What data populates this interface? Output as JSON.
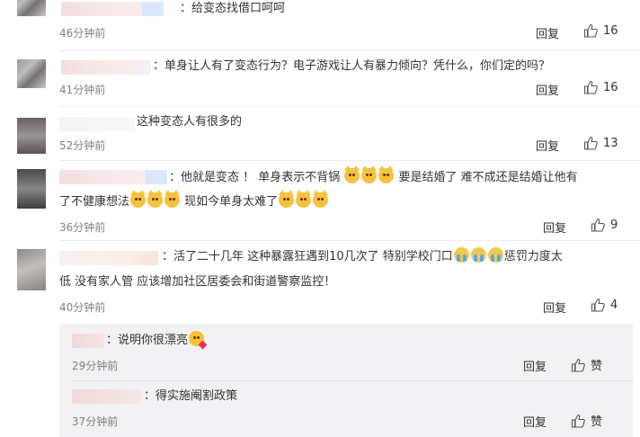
{
  "comments": [
    {
      "text": "：给变态找借口呵呵",
      "time": "46分钟前",
      "reply": "回复",
      "likes": "16"
    },
    {
      "text": "：单身让人有了变态行为？电子游戏让人有暴力倾向？凭什么，你们定的吗？",
      "time": "41分钟前",
      "reply": "回复",
      "likes": "16"
    },
    {
      "text": "这种变态人有很多的",
      "time": "52分钟前",
      "reply": "回复",
      "likes": "13"
    },
    {
      "text_1a": "：他就是变态 ！ 单身表示不背锅",
      "text_1b": "要是结婚了 难不成还是结婚让他有",
      "text_2a": "了不健康想法",
      "text_2b": "现如今单身太难了",
      "time": "36分钟前",
      "reply": "回复",
      "likes": "9"
    },
    {
      "text_1a": "：活了二十几年 这种暴露狂遇到10几次了 特别学校门口",
      "text_1b": "惩罚力度太",
      "text_2": "低 没有家人管 应该增加社区居委会和街道警察监控！",
      "time": "40分钟前",
      "reply": "回复",
      "likes": "4"
    }
  ],
  "sub_replies": [
    {
      "text": "：说明你很漂亮",
      "time": "29分钟前",
      "reply": "回复",
      "like_label": "赞"
    },
    {
      "text": "：得实施阉割政策",
      "time": "37分钟前",
      "reply": "回复",
      "like_label": "赞"
    }
  ]
}
